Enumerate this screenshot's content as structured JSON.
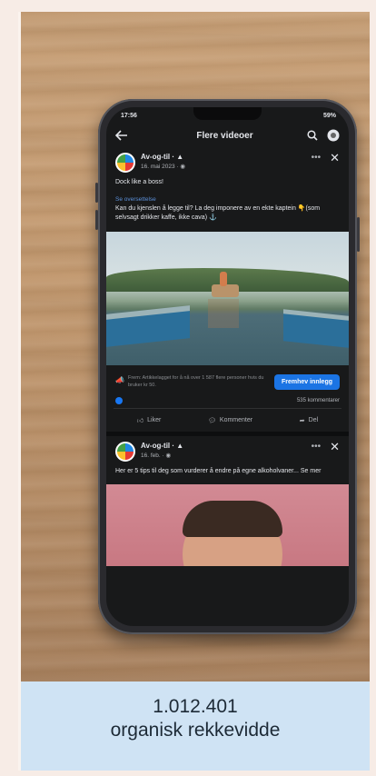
{
  "status_bar": {
    "time": "17:56",
    "battery": "59%"
  },
  "topbar": {
    "back_icon": "arrow-left-icon",
    "title": "Flere videoer",
    "search_icon": "search-icon",
    "profile_icon": "messenger-icon"
  },
  "post1": {
    "page_name": "Av-og-til ·",
    "date": "16. mai 2023 · ",
    "text": "Dock like a boss!",
    "link_label": "Se oversettelse",
    "body": "Kan du kjenslen å legge til? La deg imponere av en ekte kaptein 👇(som selvsagt drikker kaffe, ikke cava) ⚓",
    "promo_text": "Frem: Artikkelagget for å nå over 1 587 flere personer hvis du bruker kr 50.",
    "boost_label": "Fremhev innlegg",
    "comments": "535 kommentarer"
  },
  "actions": {
    "like": "Liker",
    "comment": "Kommenter",
    "share": "Del"
  },
  "post2": {
    "page_name": "Av-og-til ·",
    "date": "16. feb. · ",
    "text": "Her er 5 tips til deg som vurderer å endre på egne alkoholvaner... Se mer"
  },
  "caption": {
    "number": "1.012.401",
    "label": "organisk rekkevidde"
  },
  "colors": {
    "accent": "#1b74e4",
    "caption_bg": "#cfe3f4",
    "screen_bg": "#18191a"
  }
}
